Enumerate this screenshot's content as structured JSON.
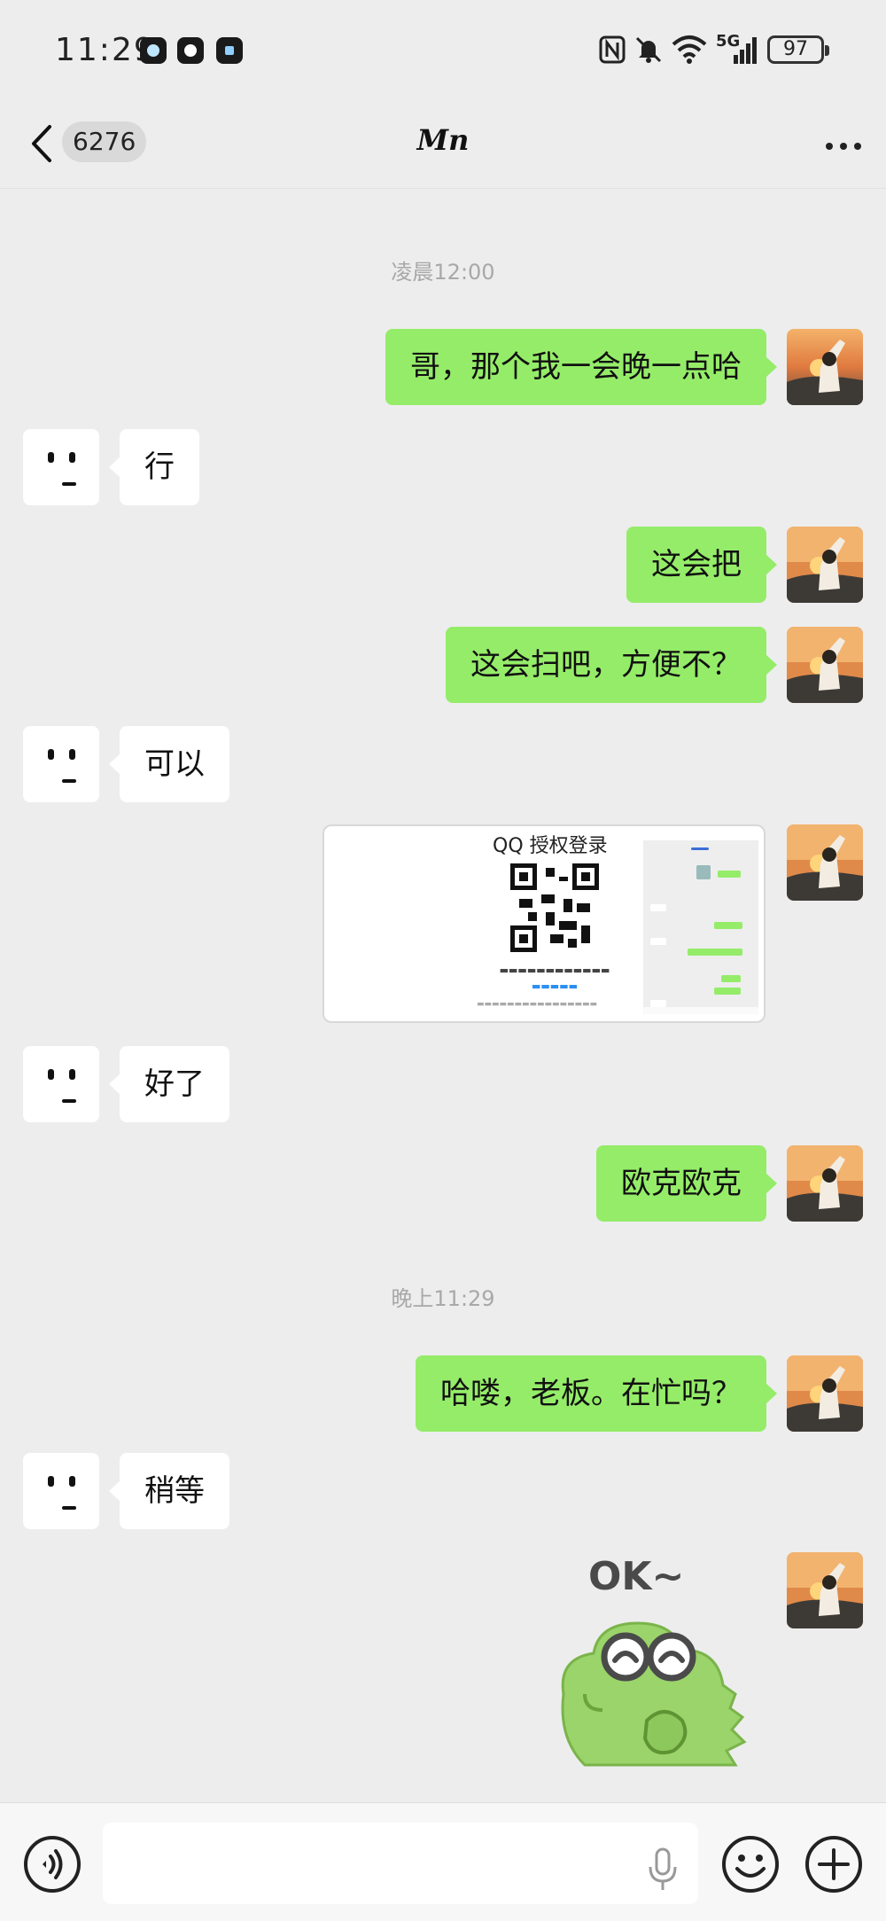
{
  "status_bar": {
    "time": "11:29",
    "network": "5G",
    "battery": "97"
  },
  "header": {
    "unread_count": "6276",
    "title": "Mn"
  },
  "messages": [
    {
      "type": "timestamp",
      "text": "凌晨12:00"
    },
    {
      "type": "text",
      "side": "right",
      "text": "哥，那个我一会晚一点哈"
    },
    {
      "type": "text",
      "side": "left",
      "text": "行"
    },
    {
      "type": "text",
      "side": "right",
      "text": "这会把"
    },
    {
      "type": "text",
      "side": "right",
      "text": "这会扫吧，方便不？"
    },
    {
      "type": "text",
      "side": "left",
      "text": "可以"
    },
    {
      "type": "image",
      "side": "right",
      "caption": "QQ 授权登录"
    },
    {
      "type": "text",
      "side": "left",
      "text": "好了"
    },
    {
      "type": "text",
      "side": "right",
      "text": "欧克欧克"
    },
    {
      "type": "timestamp",
      "text": "晚上11:29"
    },
    {
      "type": "text",
      "side": "right",
      "text": "哈喽，老板。在忙吗？"
    },
    {
      "type": "text",
      "side": "left",
      "text": "稍等"
    },
    {
      "type": "sticker",
      "side": "right",
      "text": "OK~"
    }
  ],
  "colors": {
    "background": "#ededed",
    "bubble_self": "#95ec69",
    "bubble_other": "#ffffff",
    "timestamp": "#a8a8a8"
  },
  "icons": [
    "back-icon",
    "more-icon",
    "voice-icon",
    "microphone-icon",
    "emoji-icon",
    "plus-icon",
    "nfc-icon",
    "mute-bell-icon",
    "wifi-icon",
    "signal-icon",
    "battery-icon"
  ]
}
